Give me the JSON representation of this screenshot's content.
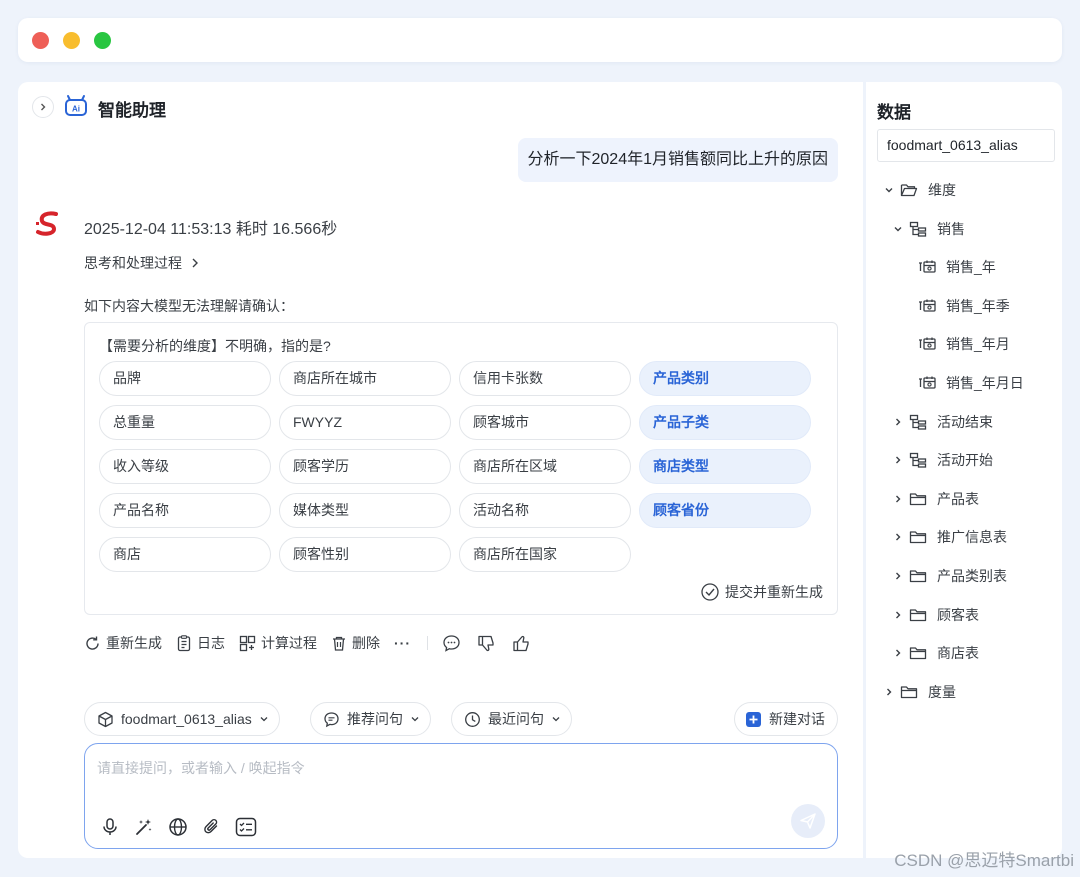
{
  "assistant": {
    "title": "智能助理"
  },
  "user_message": "分析一下2024年1月销售额同比上升的原因",
  "answer": {
    "meta": "2025-12-04 11:53:13 耗时 16.566秒",
    "think_label": "思考和处理过程",
    "confirm_prompt": "如下内容大模型无法理解请确认：",
    "question": "【需要分析的维度】不明确，指的是?",
    "submit_label": "提交并重新生成",
    "options": [
      {
        "label": "品牌",
        "selected": false
      },
      {
        "label": "商店所在城市",
        "selected": false
      },
      {
        "label": "信用卡张数",
        "selected": false
      },
      {
        "label": "产品类别",
        "selected": true
      },
      {
        "label": "总重量",
        "selected": false
      },
      {
        "label": "FWYYZ",
        "selected": false
      },
      {
        "label": "顾客城市",
        "selected": false
      },
      {
        "label": "产品子类",
        "selected": true
      },
      {
        "label": "收入等级",
        "selected": false
      },
      {
        "label": "顾客学历",
        "selected": false
      },
      {
        "label": "商店所在区域",
        "selected": false
      },
      {
        "label": "商店类型",
        "selected": true
      },
      {
        "label": "产品名称",
        "selected": false
      },
      {
        "label": "媒体类型",
        "selected": false
      },
      {
        "label": "活动名称",
        "selected": false
      },
      {
        "label": "顾客省份",
        "selected": true
      },
      {
        "label": "商店",
        "selected": false
      },
      {
        "label": "顾客性别",
        "selected": false
      },
      {
        "label": "商店所在国家",
        "selected": false
      }
    ]
  },
  "actions": {
    "regenerate": "重新生成",
    "log": "日志",
    "calc": "计算过程",
    "delete": "删除",
    "more": "···"
  },
  "input": {
    "dataset": "foodmart_0613_alias",
    "recommend": "推荐问句",
    "recent": "最近问句",
    "new_chat": "新建对话",
    "placeholder": "请直接提问，或者输入 / 唤起指令"
  },
  "side": {
    "title": "数据",
    "dataset": "foodmart_0613_alias",
    "tree": [
      {
        "label": "维度",
        "level": 0,
        "expanded": true,
        "icon": "folder-open-icon"
      },
      {
        "label": "销售",
        "level": 1,
        "expanded": true,
        "icon": "hierarchy-icon"
      },
      {
        "label": "销售_年",
        "level": 2,
        "icon": "date-field-icon"
      },
      {
        "label": "销售_年季",
        "level": 2,
        "icon": "date-field-icon"
      },
      {
        "label": "销售_年月",
        "level": 2,
        "icon": "date-field-icon"
      },
      {
        "label": "销售_年月日",
        "level": 2,
        "icon": "date-field-icon"
      },
      {
        "label": "活动结束",
        "level": 1,
        "expanded": false,
        "icon": "hierarchy-icon"
      },
      {
        "label": "活动开始",
        "level": 1,
        "expanded": false,
        "icon": "hierarchy-icon"
      },
      {
        "label": "产品表",
        "level": 1,
        "expanded": false,
        "icon": "folder-icon"
      },
      {
        "label": "推广信息表",
        "level": 1,
        "expanded": false,
        "icon": "folder-icon"
      },
      {
        "label": "产品类别表",
        "level": 1,
        "expanded": false,
        "icon": "folder-icon"
      },
      {
        "label": "顾客表",
        "level": 1,
        "expanded": false,
        "icon": "folder-icon"
      },
      {
        "label": "商店表",
        "level": 1,
        "expanded": false,
        "icon": "folder-icon"
      },
      {
        "label": "度量",
        "level": 0,
        "expanded": false,
        "icon": "folder-icon"
      }
    ]
  },
  "watermark": "CSDN @思迈特Smartbi",
  "colors": {
    "accent": "#2a64d6",
    "chip_selected_bg": "#eaf1fc",
    "brand_red": "#d6242b"
  }
}
